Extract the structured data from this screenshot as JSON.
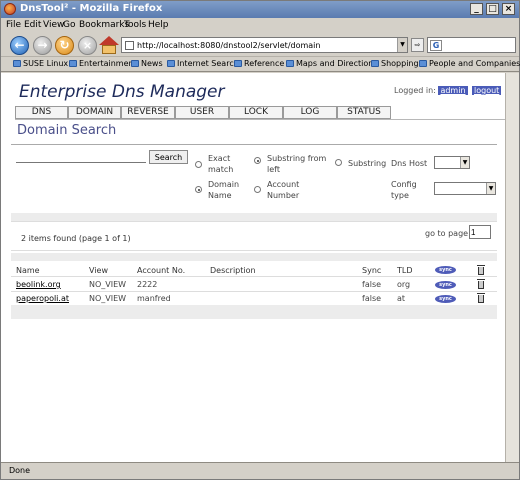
{
  "window": {
    "title": "DnsTool² - Mozilla Firefox"
  },
  "menu": [
    "File",
    "Edit",
    "View",
    "Go",
    "Bookmarks",
    "Tools",
    "Help"
  ],
  "address": {
    "url": "http://localhost:8080/dnstool2/servlet/domain"
  },
  "search_engine": {
    "icon": "G"
  },
  "bookmarks": [
    "SUSE Linux",
    "Entertainment",
    "News",
    "Internet Search",
    "Reference",
    "Maps and Directions",
    "Shopping",
    "People and Companies"
  ],
  "app": {
    "title": "Enterprise Dns Manager",
    "logged_in_label": "Logged in:",
    "user": "admin",
    "logout": "logout"
  },
  "tabs": [
    "DNS",
    "DOMAIN",
    "REVERSE",
    "USER",
    "LOCK",
    "LOG",
    "STATUS"
  ],
  "page": {
    "title": "Domain Search"
  },
  "search": {
    "input_value": "",
    "button_label": "Search",
    "options": [
      {
        "label": "Exact match",
        "selected": false
      },
      {
        "label": "Substring from left",
        "selected": true
      },
      {
        "label": "Substring",
        "selected": false
      },
      {
        "label": "Domain Name",
        "selected": true
      },
      {
        "label": "Account Number",
        "selected": false
      }
    ],
    "dns_host_label": "Dns Host",
    "dns_host_value": "",
    "config_type_label": "Config type",
    "config_type_value": ""
  },
  "results": {
    "summary": "2 items found (page 1 of 1)",
    "goto_label": "go to page",
    "page_value": "1"
  },
  "table": {
    "headers": {
      "name": "Name",
      "view": "View",
      "account": "Account No.",
      "description": "Description",
      "sync": "Sync",
      "tld": "TLD"
    },
    "sync_badge": "sync",
    "rows": [
      {
        "name": "beolink.org",
        "view": "NO_VIEW",
        "account": "2222",
        "description": "",
        "sync": "false",
        "tld": "org"
      },
      {
        "name": "paperopoli.at",
        "view": "NO_VIEW",
        "account": "manfred",
        "description": "",
        "sync": "false",
        "tld": "at"
      }
    ]
  },
  "status": {
    "text": "Done"
  },
  "colors": {
    "accent": "#4a5bb8",
    "title": "#1d2a5a",
    "page_title": "#4a4f8a"
  }
}
